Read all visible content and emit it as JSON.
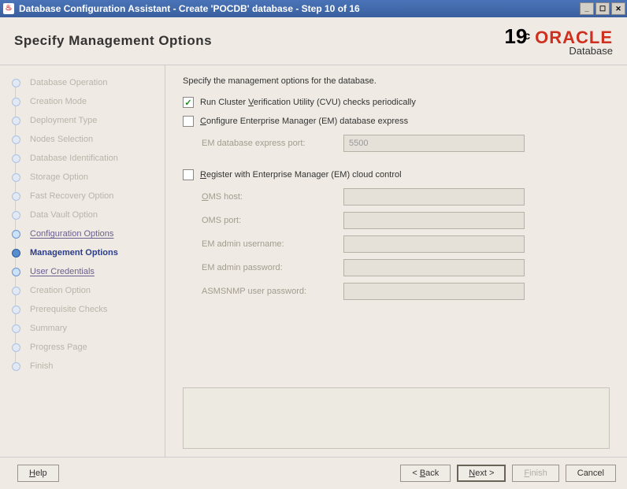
{
  "titlebar": {
    "title": "Database Configuration Assistant - Create 'POCDB' database - Step 10 of 16"
  },
  "header": {
    "page_title": "Specify Management Options",
    "brand_version": "19",
    "brand_c": "c",
    "brand_name": "ORACLE",
    "brand_product": "Database"
  },
  "sidebar": {
    "steps": [
      {
        "label": "Database Operation",
        "state": "past"
      },
      {
        "label": "Creation Mode",
        "state": "past"
      },
      {
        "label": "Deployment Type",
        "state": "past"
      },
      {
        "label": "Nodes Selection",
        "state": "past"
      },
      {
        "label": "Database Identification",
        "state": "past"
      },
      {
        "label": "Storage Option",
        "state": "past"
      },
      {
        "label": "Fast Recovery Option",
        "state": "past"
      },
      {
        "label": "Data Vault Option",
        "state": "past"
      },
      {
        "label": "Configuration Options",
        "state": "done"
      },
      {
        "label": "Management Options",
        "state": "current"
      },
      {
        "label": "User Credentials",
        "state": "done"
      },
      {
        "label": "Creation Option",
        "state": "future"
      },
      {
        "label": "Prerequisite Checks",
        "state": "future"
      },
      {
        "label": "Summary",
        "state": "future"
      },
      {
        "label": "Progress Page",
        "state": "future"
      },
      {
        "label": "Finish",
        "state": "future"
      }
    ]
  },
  "main": {
    "instruction": "Specify the management options for the database.",
    "cvu_checkbox_checked": true,
    "cvu_label_pre": "Run Cluster ",
    "cvu_label_u": "V",
    "cvu_label_post": "erification Utility (CVU) checks periodically",
    "em_express_checked": false,
    "em_express_pre": "C",
    "em_express_post": "onfigure Enterprise Manager (EM) database express",
    "em_port_label": "EM database express port:",
    "em_port_value": "5500",
    "em_cloud_checked": false,
    "em_cloud_pre": "R",
    "em_cloud_post": "egister with Enterprise Manager (EM) cloud control",
    "oms_host_label_u": "O",
    "oms_host_label_post": "MS host:",
    "oms_host_value": "",
    "oms_port_label": "OMS port:",
    "oms_port_value": "",
    "em_admin_user_label": "EM admin username:",
    "em_admin_user_value": "",
    "em_admin_pw_label": "EM admin password:",
    "em_admin_pw_value": "",
    "asmsnmp_label": "ASMSNMP user password:",
    "asmsnmp_value": ""
  },
  "footer": {
    "help_u": "H",
    "help_post": "elp",
    "back_pre": "< ",
    "back_u": "B",
    "back_post": "ack",
    "next_u": "N",
    "next_post": "ext >",
    "finish_u": "F",
    "finish_post": "inish",
    "cancel": "Cancel"
  }
}
